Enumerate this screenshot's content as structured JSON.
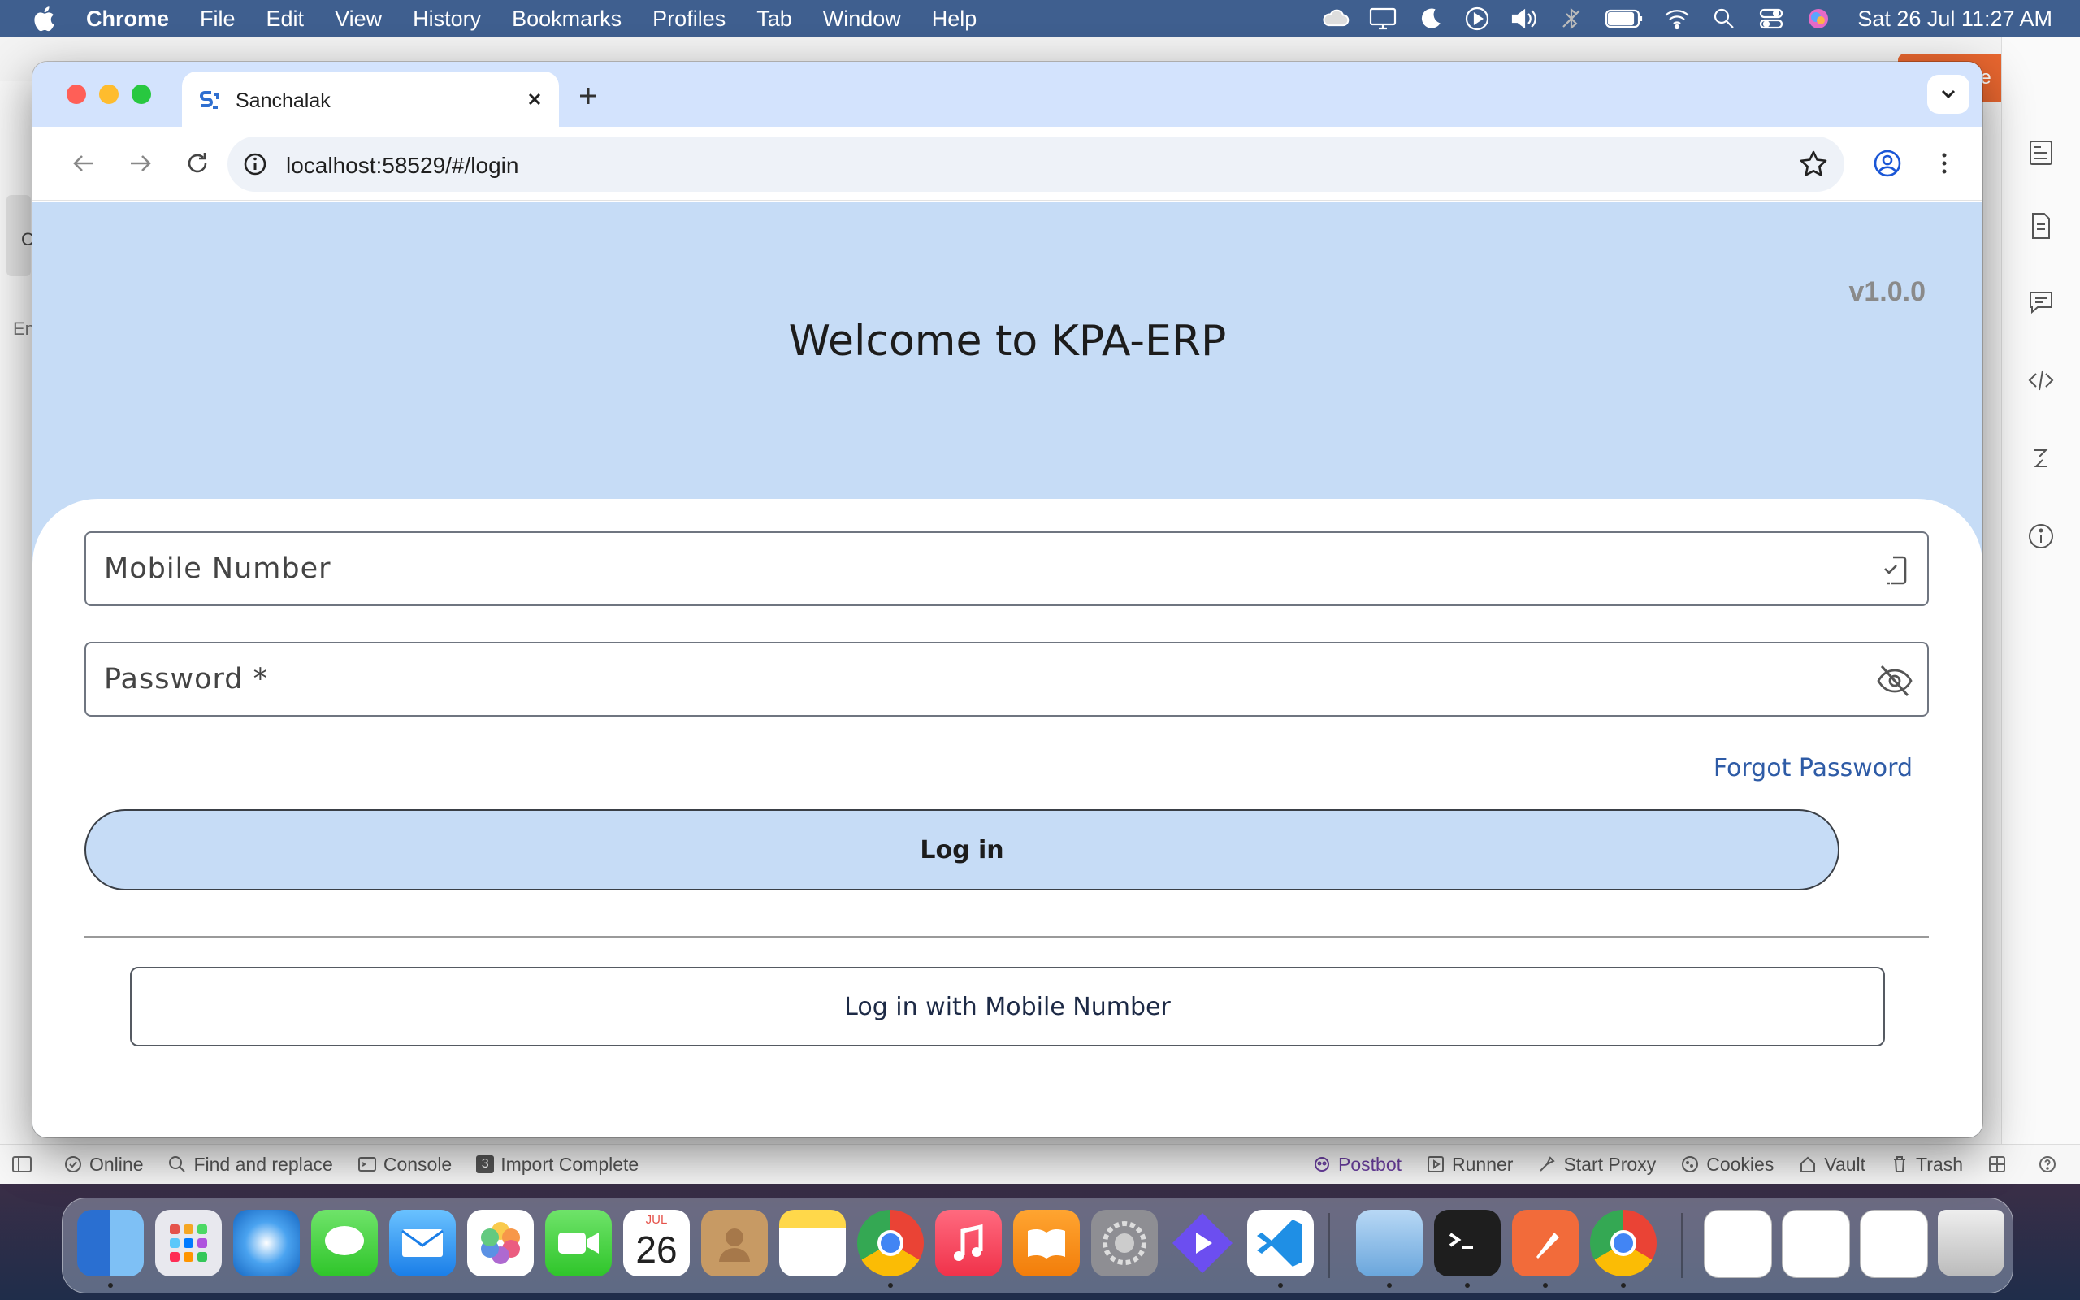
{
  "menubar": {
    "app_name": "Chrome",
    "items": [
      "File",
      "Edit",
      "View",
      "History",
      "Bookmarks",
      "Profiles",
      "Tab",
      "Window",
      "Help"
    ],
    "clock": "Sat 26 Jul  11:27 AM"
  },
  "browser": {
    "tab_title": "Sanchalak",
    "url": "localhost:58529/#/login"
  },
  "page": {
    "version": "v1.0.0",
    "welcome_title": "Welcome to KPA-ERP",
    "mobile_placeholder": "Mobile Number",
    "password_placeholder": "Password *",
    "forgot_password": "Forgot Password",
    "login_label": "Log in",
    "mobile_login_label": "Log in with Mobile Number"
  },
  "background_app": {
    "status_left": [
      "Online",
      "Find and replace",
      "Console",
      "Import Complete"
    ],
    "import_badge": "3",
    "status_right": [
      "Postbot",
      "Runner",
      "Start Proxy",
      "Cookies",
      "Vault",
      "Trash"
    ],
    "left_trunc_1": "C",
    "left_trunc_2": "En",
    "orange_button_text": "le"
  },
  "dock": {
    "calendar_month": "JUL",
    "calendar_day": "26"
  },
  "colors": {
    "page_header_bg": "#c6dcf6",
    "link": "#2e5ba6",
    "tabstrip": "#d3e3fd"
  }
}
